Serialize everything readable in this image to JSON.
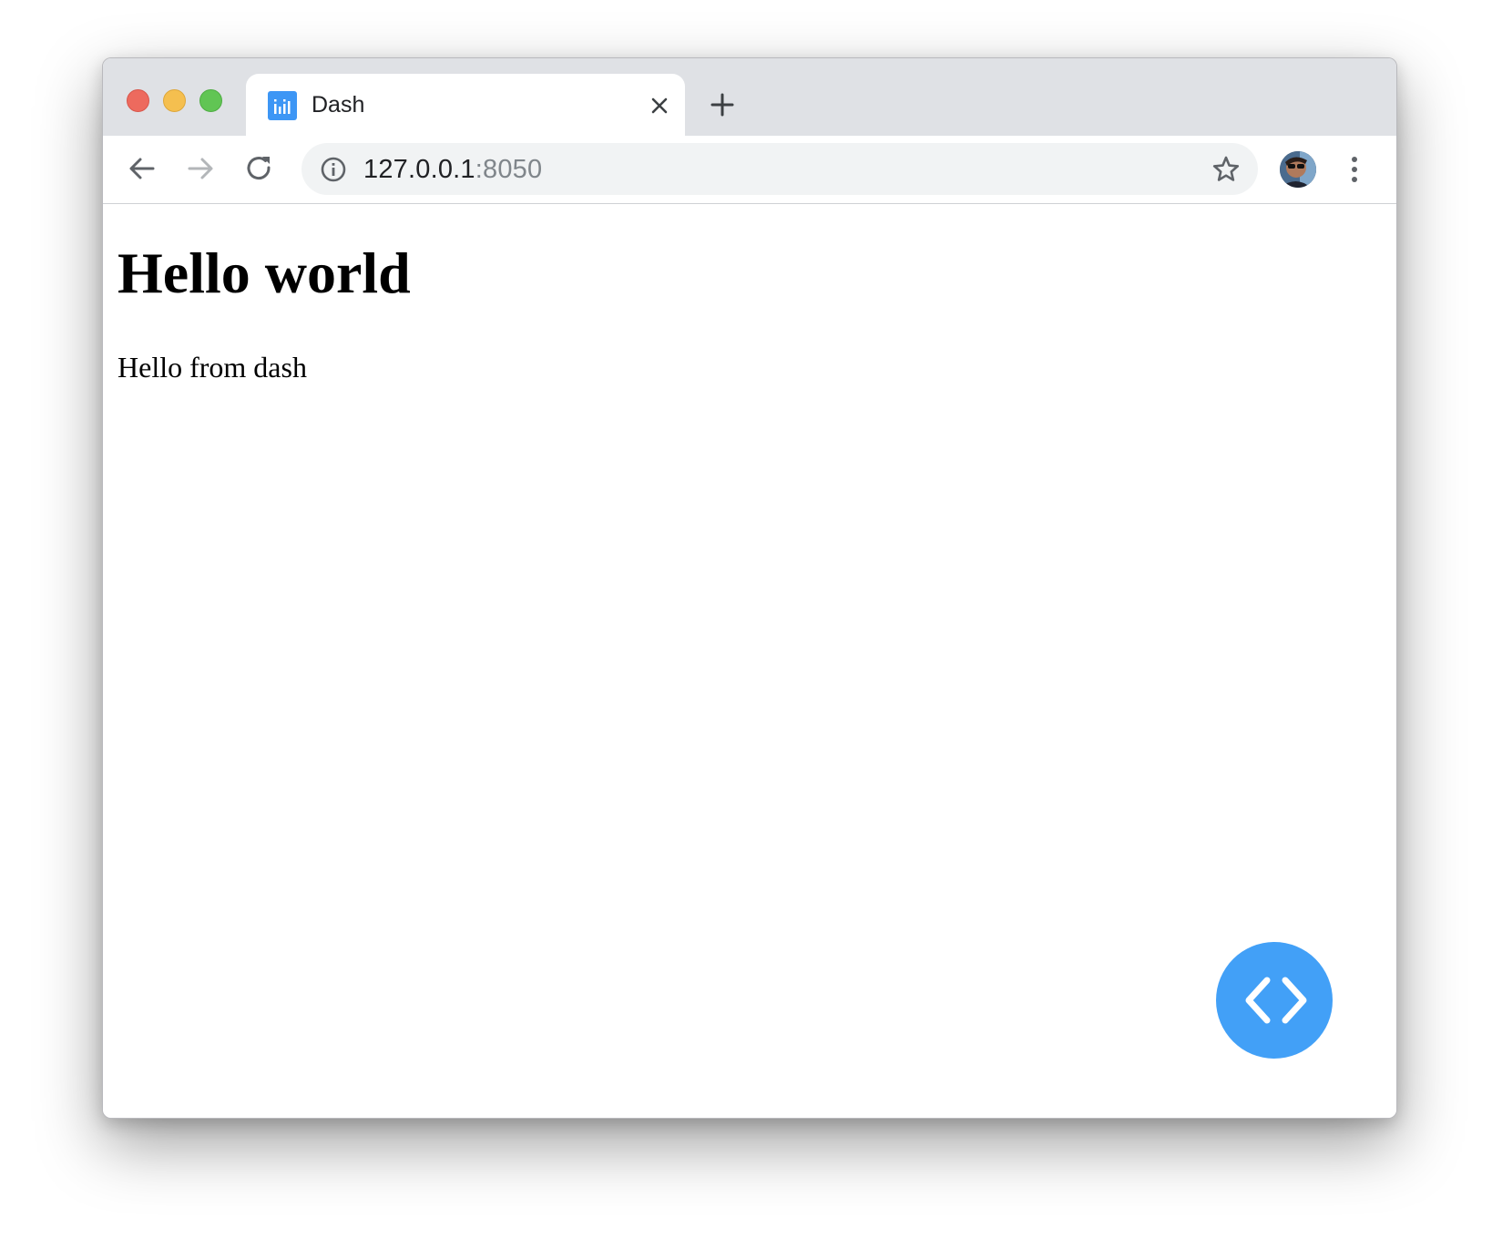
{
  "browser": {
    "tab": {
      "title": "Dash",
      "favicon": "dash-bars-icon"
    },
    "address_bar": {
      "host": "127.0.0.1",
      "port": ":8050"
    }
  },
  "page": {
    "heading": "Hello world",
    "paragraph": "Hello from dash"
  },
  "colors": {
    "tabstrip_bg": "#dfe1e5",
    "omnibox_bg": "#f1f3f4",
    "accent": "#42a0f7",
    "close": "#ed6a5e",
    "minimize": "#f5bf4f",
    "maximize": "#61c554"
  },
  "icons": {
    "back": "arrow-left-icon",
    "forward": "arrow-right-icon",
    "reload": "reload-icon",
    "info": "info-icon",
    "star": "star-icon",
    "menu": "kebab-menu-icon",
    "new_tab": "plus-icon",
    "tab_close": "close-icon",
    "debug": "code-brackets-icon"
  }
}
